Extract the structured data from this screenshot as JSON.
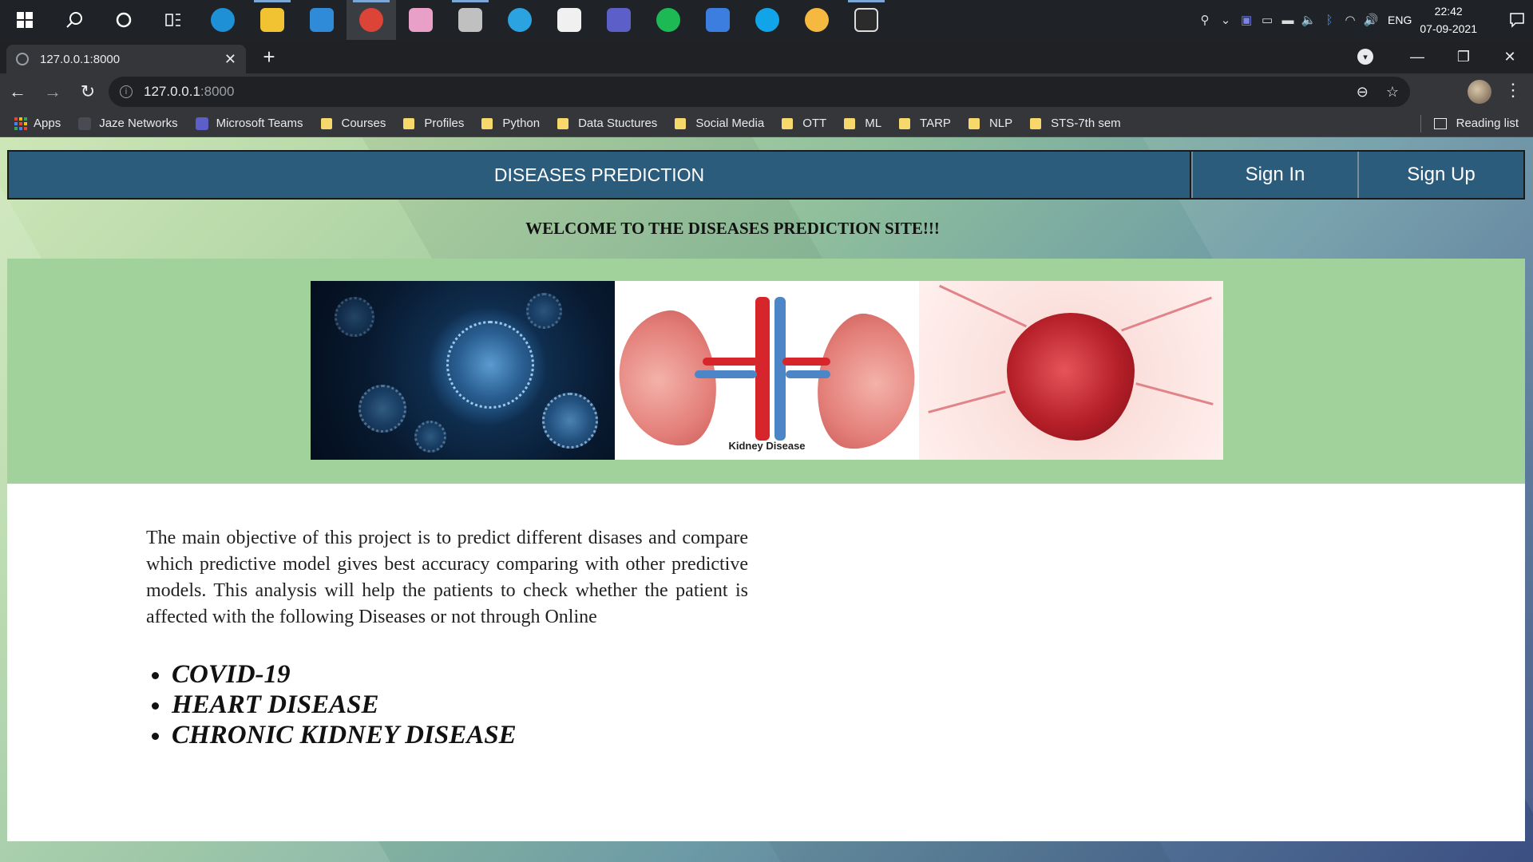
{
  "taskbar": {
    "apps": [
      {
        "name": "edge",
        "color": "#1e90d6"
      },
      {
        "name": "file-explorer",
        "color": "#f1c232"
      },
      {
        "name": "mail",
        "color": "#2f8bd8"
      },
      {
        "name": "chrome",
        "color": "#db4437"
      },
      {
        "name": "paint-3d",
        "color": "#e8a0c8"
      },
      {
        "name": "settings",
        "color": "#c0c0c0"
      },
      {
        "name": "telegram",
        "color": "#2aa3e0"
      },
      {
        "name": "store",
        "color": "#f0f0f0"
      },
      {
        "name": "teams",
        "color": "#5b5fc7"
      },
      {
        "name": "spotify",
        "color": "#1db954"
      },
      {
        "name": "todo",
        "color": "#3c7de0"
      },
      {
        "name": "skype",
        "color": "#12a4e8"
      },
      {
        "name": "weather",
        "color": "#f5b940"
      },
      {
        "name": "terminal",
        "color": "#2b2b2b"
      }
    ],
    "tray": {
      "language": "ENG",
      "time": "22:42",
      "date": "07-09-2021"
    }
  },
  "browser": {
    "tab_title": "127.0.0.1:8000",
    "url_host": "127.0.0.1",
    "url_port": ":8000",
    "bookmarks": [
      {
        "label": "Apps",
        "type": "apps"
      },
      {
        "label": "Jaze Networks",
        "type": "generic",
        "color": "#4a4a52"
      },
      {
        "label": "Microsoft Teams",
        "type": "generic",
        "color": "#5b5fc7"
      },
      {
        "label": "Courses",
        "type": "folder"
      },
      {
        "label": "Profiles",
        "type": "folder"
      },
      {
        "label": "Python",
        "type": "folder"
      },
      {
        "label": "Data Stuctures",
        "type": "folder"
      },
      {
        "label": "Social Media",
        "type": "folder"
      },
      {
        "label": "OTT",
        "type": "folder"
      },
      {
        "label": "ML",
        "type": "folder"
      },
      {
        "label": "TARP",
        "type": "folder"
      },
      {
        "label": "NLP",
        "type": "folder"
      },
      {
        "label": "STS-7th sem",
        "type": "folder"
      }
    ],
    "reading_list": "Reading list"
  },
  "site": {
    "brand": "DISEASES PREDICTION",
    "sign_in": "Sign In",
    "sign_up": "Sign Up",
    "welcome": "WELCOME TO THE DISEASES PREDICTION SITE!!!",
    "kidney_caption": "Kidney Disease",
    "objective": "The main objective of this project is to predict different disases and compare which predictive model gives best accuracy comparing with other predictive models. This analysis will help the patients to check whether the patient is affected with the following Diseases or not through Online",
    "diseases": [
      "COVID-19",
      "HEART DISEASE",
      "CHRONIC KIDNEY DISEASE"
    ],
    "colors": {
      "navbar": "#2c5c7c",
      "banner": "#a1d29c",
      "content": "#ffffff"
    }
  }
}
